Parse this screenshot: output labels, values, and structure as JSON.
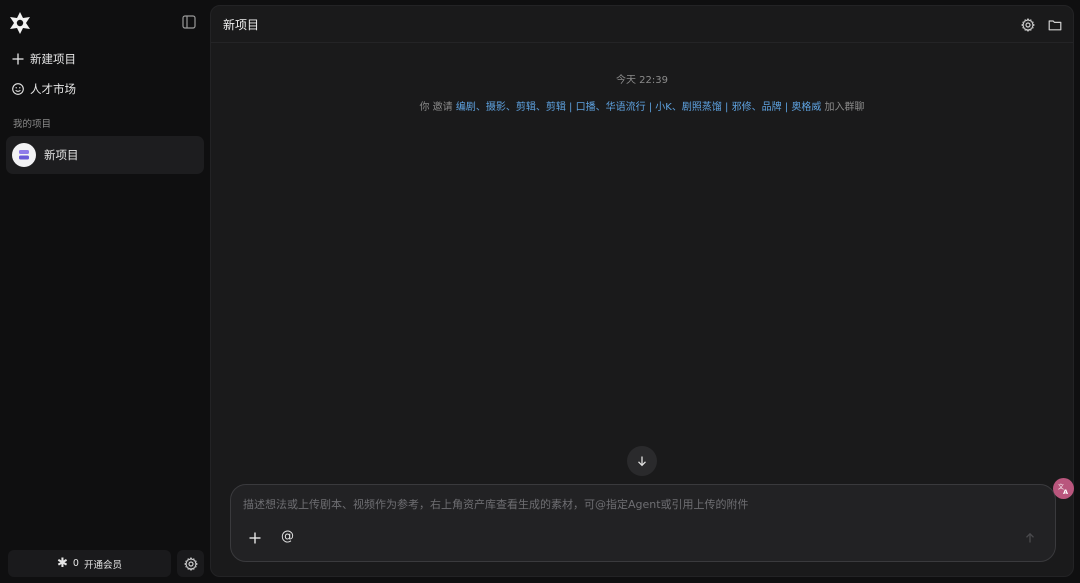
{
  "sidebar": {
    "logo": "app-logo",
    "new_project_label": "新建项目",
    "talent_market_label": "人才市场",
    "my_projects_label": "我的项目",
    "projects": [
      {
        "label": "新项目"
      }
    ],
    "credits": "0",
    "membership_label": "开通会员"
  },
  "main": {
    "title": "新项目",
    "timestamp": "今天 22:39",
    "invite": {
      "inviter": "你",
      "verb": "邀请",
      "names": "编剧、摄影、剪辑、剪辑 | 口播、华语流行 | 小K、剧照蒸馏 | 邪修、品牌 | 奥格威",
      "suffix": "加入群聊"
    },
    "composer": {
      "placeholder": "描述想法或上传剧本、视频作为参考，右上角资产库查看生成的素材，可@指定Agent或引用上传的附件",
      "value": "",
      "mention_symbol": "@"
    }
  },
  "colors": {
    "accent_link": "#5ea2e0",
    "translate_fab": "#b9567d"
  }
}
